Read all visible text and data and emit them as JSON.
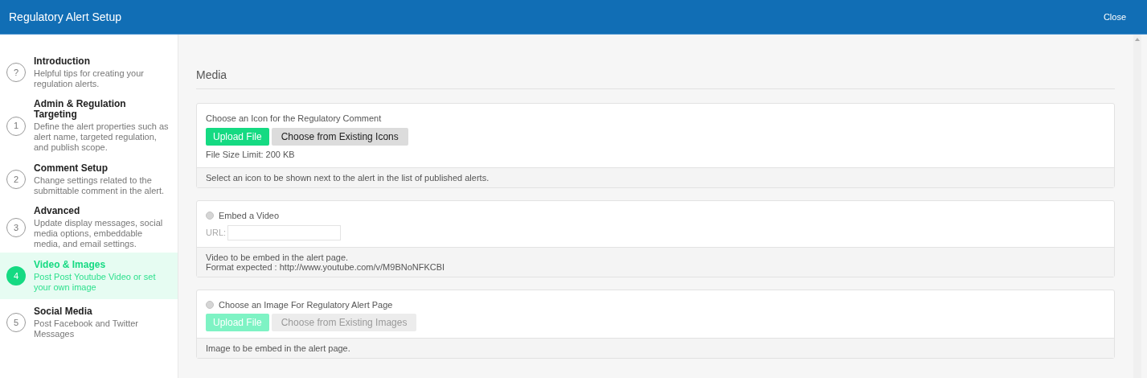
{
  "header": {
    "title": "Regulatory Alert Setup",
    "close": "Close"
  },
  "steps": [
    {
      "marker": "?",
      "title": "Introduction",
      "description": "Helpful tips for creating your regulation alerts.",
      "selected": false
    },
    {
      "marker": "1",
      "title": "Admin & Regulation Targeting",
      "description": "Define the alert properties such as alert name, targeted regulation, and publish scope.",
      "selected": false
    },
    {
      "marker": "2",
      "title": "Comment Setup",
      "description": "Change settings related to the submittable comment in the alert.",
      "selected": false
    },
    {
      "marker": "3",
      "title": "Advanced",
      "description": "Update display messages, social media options, embeddable media, and email settings.",
      "selected": false
    },
    {
      "marker": "4",
      "title": "Video & Images",
      "description": "Post Post Youtube Video or set your own image",
      "selected": true
    },
    {
      "marker": "5",
      "title": "Social Media",
      "description": "Post Facebook and Twitter Messages",
      "selected": false
    }
  ],
  "section_title": "Media",
  "panels": [
    {
      "kind": "upload",
      "label": "Choose an Icon for the Regulatory Comment",
      "disabled": false,
      "buttons": [
        "Upload File",
        "Choose from Existing Icons"
      ],
      "note": "File Size Limit: 200 KB",
      "footer": [
        "Select an icon to be shown next to the alert in the list of published alerts."
      ]
    },
    {
      "kind": "video",
      "radio": {
        "label": "Embed a Video",
        "checked": false
      },
      "url_label": "URL:",
      "footer": [
        "Video to be embed in the alert page.",
        "Format expected : http://www.youtube.com/v/M9BNoNFKCBI"
      ]
    },
    {
      "kind": "image",
      "radio": {
        "label": "Choose an Image For Regulatory Alert Page",
        "checked": false
      },
      "disabled": true,
      "buttons": [
        "Upload File",
        "Choose from Existing Images"
      ],
      "footer": [
        "Image to be embed in the alert page."
      ]
    }
  ]
}
